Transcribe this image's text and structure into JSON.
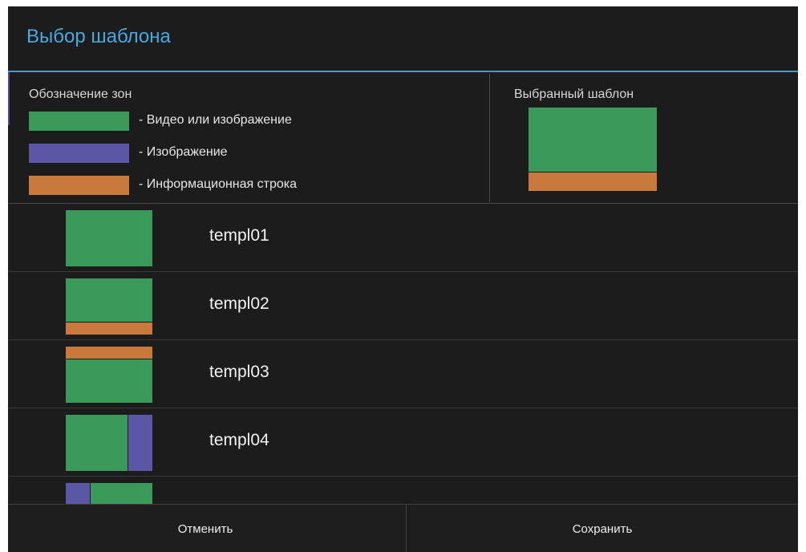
{
  "dialog": {
    "title": "Выбор шаблона"
  },
  "legend": {
    "title": "Обозначение зон",
    "items": [
      {
        "label": "- Видео или изображение",
        "color": "#3a9a5a",
        "icon": "video-zone-swatch"
      },
      {
        "label": "- Изображение",
        "color": "#5b57a6",
        "icon": "image-zone-swatch"
      },
      {
        "label": "- Информационная строка",
        "color": "#c9793c",
        "icon": "info-line-zone-swatch"
      }
    ]
  },
  "selected": {
    "title": "Выбранный шаблон",
    "template": "templ02"
  },
  "colors": {
    "video": "#3a9a5a",
    "image": "#5b57a6",
    "info": "#c9793c",
    "accent": "#3f9bd1"
  },
  "templates": [
    {
      "name": "templ01"
    },
    {
      "name": "templ02"
    },
    {
      "name": "templ03"
    },
    {
      "name": "templ04"
    },
    {
      "name": ""
    }
  ],
  "footer": {
    "cancel_label": "Отменить",
    "save_label": "Сохранить"
  }
}
